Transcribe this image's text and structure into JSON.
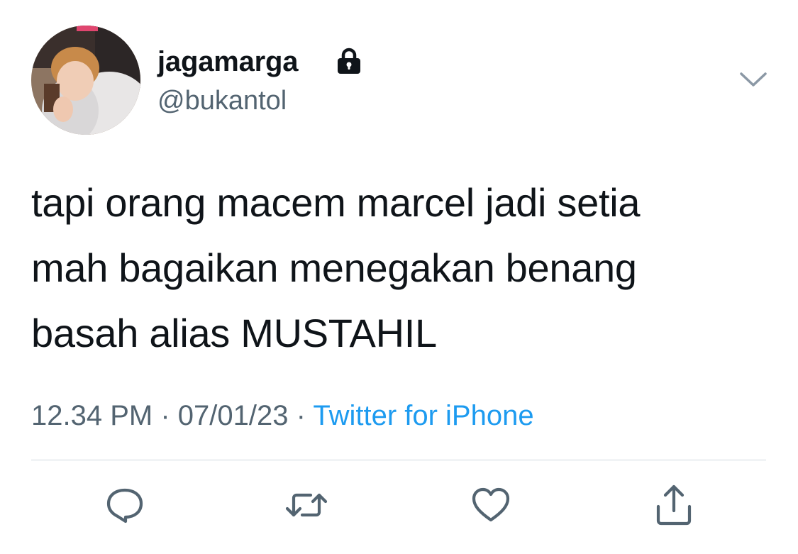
{
  "user": {
    "display_name": "jagamarga",
    "handle": "@bukantol",
    "protected_icon": "lock-icon",
    "avatar_icon": "profile-photo"
  },
  "menu": {
    "icon": "chevron-down-icon"
  },
  "tweet": {
    "text_lines": [
      "tapi orang macem marcel jadi setia",
      "mah bagaikan menegakan benang",
      "basah alias MUSTAHIL"
    ],
    "time": "12.34 PM",
    "date": "07/01/23",
    "separator": "·",
    "source": "Twitter for iPhone"
  },
  "actions": [
    {
      "name": "reply",
      "icon": "reply-icon"
    },
    {
      "name": "retweet",
      "icon": "retweet-icon"
    },
    {
      "name": "like",
      "icon": "heart-icon"
    },
    {
      "name": "share",
      "icon": "share-icon"
    }
  ],
  "colors": {
    "text": "#0f1419",
    "secondary": "#536471",
    "link": "#1d9bf0",
    "divider": "#cfd9de"
  }
}
